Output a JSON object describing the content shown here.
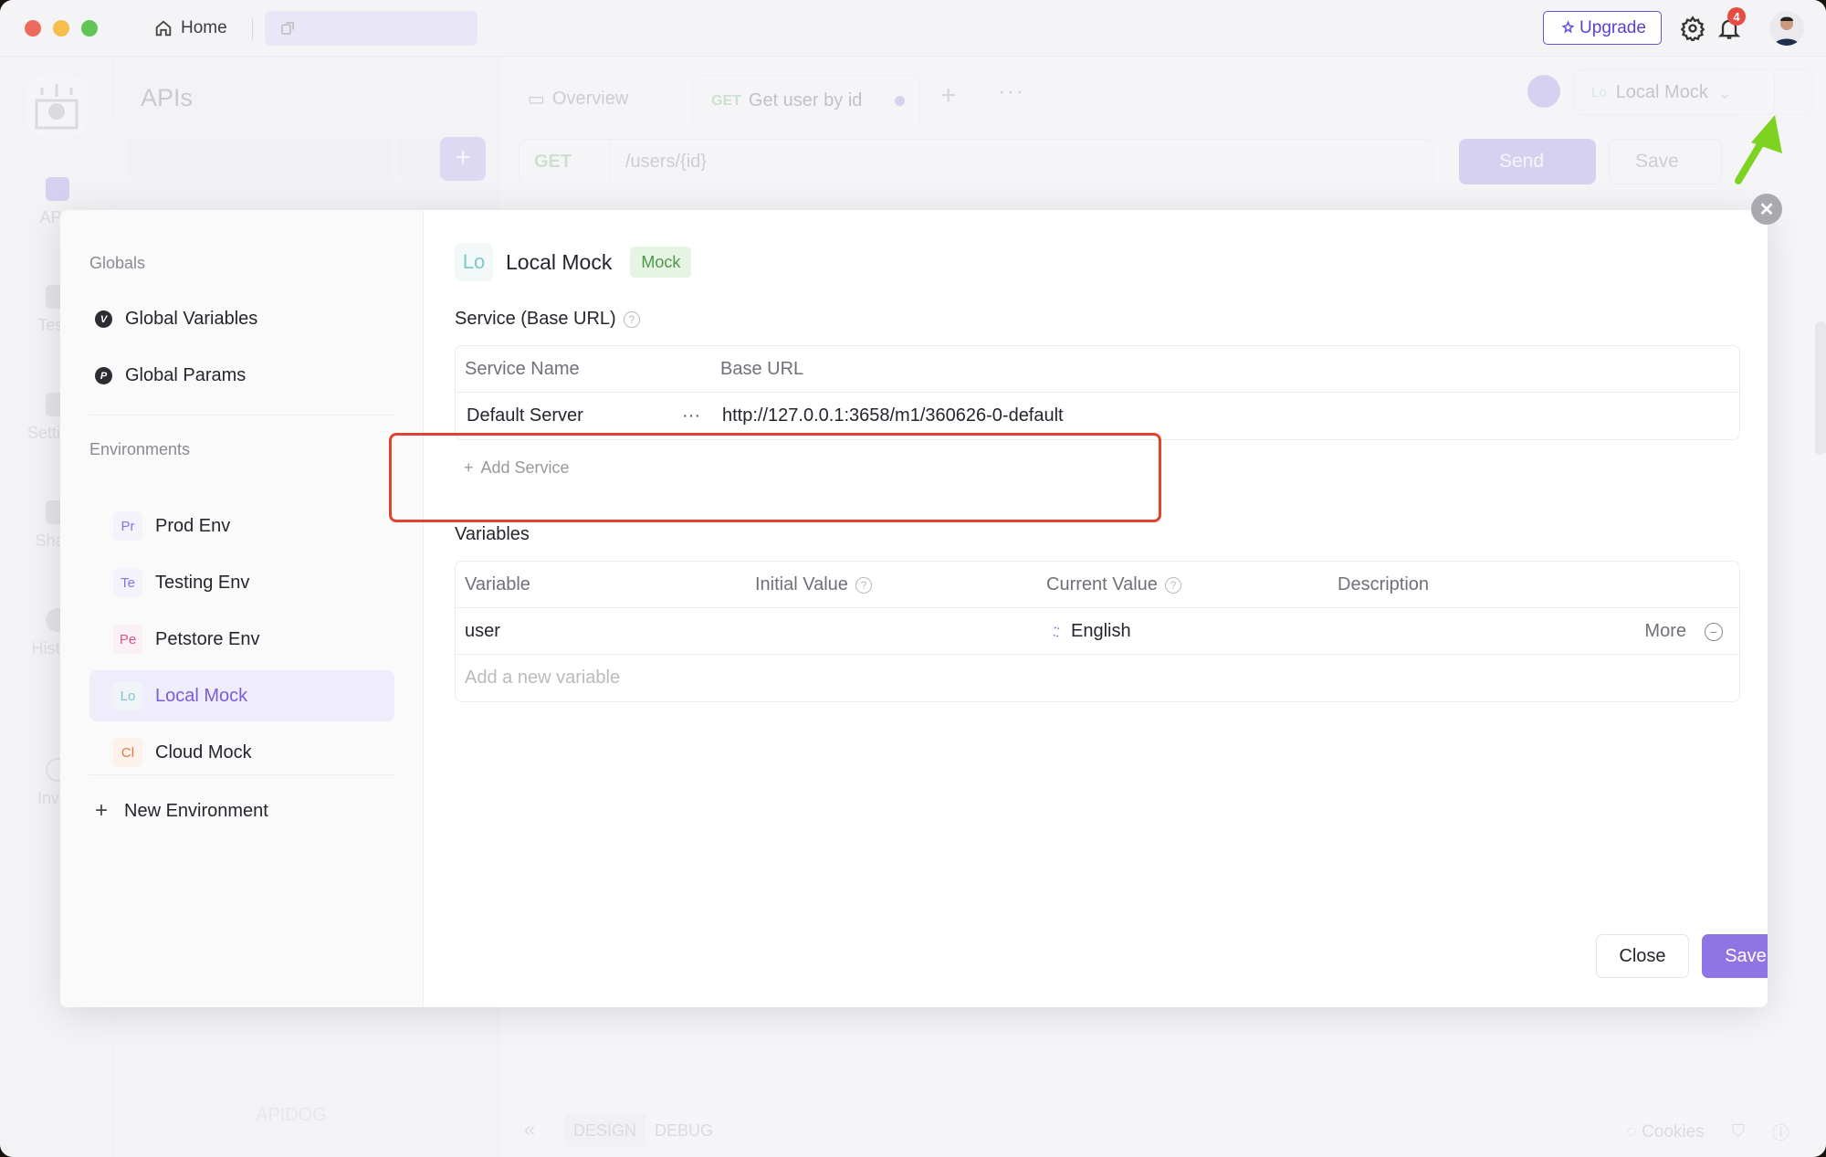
{
  "titlebar": {
    "home_label": "Home",
    "upgrade_label": "Upgrade",
    "notification_count": "4"
  },
  "rail": {
    "items": [
      {
        "label": "APIs",
        "icon": "apis-icon"
      },
      {
        "label": "Tests",
        "icon": "tests-icon"
      },
      {
        "label": "Settings",
        "icon": "settings-icon"
      },
      {
        "label": "Share",
        "icon": "share-icon"
      },
      {
        "label": "History",
        "icon": "history-icon"
      },
      {
        "label": "Invite",
        "icon": "invite-icon"
      }
    ]
  },
  "apis_panel": {
    "title": "APIs",
    "search_placeholder": "",
    "brand": "APIDOG"
  },
  "editor": {
    "tabs": [
      {
        "label": "Overview"
      },
      {
        "method": "GET",
        "label": "Get user by id",
        "unsaved": true
      }
    ],
    "env_selector": {
      "abbr": "Lo",
      "label": "Local Mock"
    },
    "request": {
      "method": "GET",
      "path": "/users/{id}"
    },
    "send_label": "Send",
    "save_label": "Save",
    "bottom": {
      "mode_tabs": [
        "DESIGN",
        "DEBUG"
      ],
      "active_mode": "DEBUG",
      "cookies_label": "Cookies"
    }
  },
  "modal": {
    "sidebar": {
      "globals_header": "Globals",
      "globals": [
        {
          "label": "Global Variables",
          "icon_letter": "V"
        },
        {
          "label": "Global Params",
          "icon_letter": "P"
        }
      ],
      "environments_header": "Environments",
      "environments": [
        {
          "abbr": "Pr",
          "label": "Prod Env",
          "color": "#8b73e6",
          "bg": "#f4f2fb",
          "active": false
        },
        {
          "abbr": "Te",
          "label": "Testing Env",
          "color": "#8b73e6",
          "bg": "#f4f2fb",
          "active": false
        },
        {
          "abbr": "Pe",
          "label": "Petstore Env",
          "color": "#d2568f",
          "bg": "#fbf0f5",
          "active": false
        },
        {
          "abbr": "Lo",
          "label": "Local Mock",
          "color": "#7fc9cc",
          "bg": "#eef4f7",
          "active": true
        },
        {
          "abbr": "Cl",
          "label": "Cloud Mock",
          "color": "#e07a52",
          "bg": "#fdf1ec",
          "active": false
        }
      ],
      "new_env_label": "New Environment"
    },
    "env": {
      "abbr": "Lo",
      "name": "Local Mock",
      "tag": "Mock"
    },
    "service": {
      "title": "Service (Base URL)",
      "columns": [
        "Service Name",
        "Base URL"
      ],
      "rows": [
        {
          "name": "Default Server",
          "url": "http://127.0.0.1:3658/m1/360626-0-default"
        }
      ],
      "add_label": "Add Service"
    },
    "variables": {
      "title": "Variables",
      "columns": [
        "Variable",
        "Initial Value",
        "Current Value",
        "Description"
      ],
      "rows": [
        {
          "variable": "user",
          "initial": "",
          "current": "English",
          "description": "",
          "more": "More"
        }
      ],
      "add_placeholder": "Add a new variable"
    },
    "close_label": "Close",
    "save_label": "Save"
  },
  "colors": {
    "accent": "#8f74e4",
    "highlight_box": "#e0432f",
    "annotation_arrow": "#7ed321"
  }
}
